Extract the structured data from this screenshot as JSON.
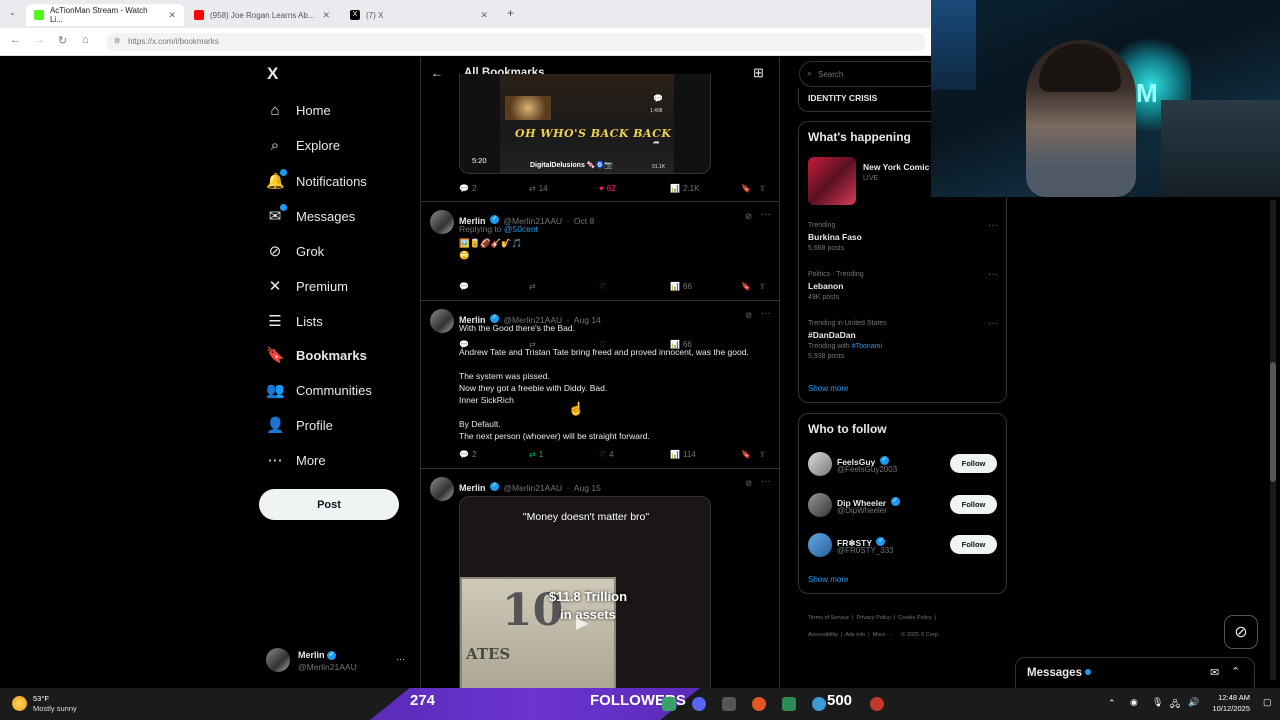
{
  "browser": {
    "tabs": [
      {
        "label": "AcTionMan Stream - Watch Li...",
        "favicon_color": "#53fc18"
      },
      {
        "label": "(958) Joe Rogan Learns Ab...",
        "favicon_color": "#ff0000"
      },
      {
        "label": "(7) X",
        "favicon_color": "#000000"
      }
    ],
    "url": "https://x.com/i/bookmarks",
    "new_tab": "+"
  },
  "sidebar": {
    "logo": "X",
    "items": [
      {
        "label": "Home",
        "icon": "home-icon",
        "glyph": "⌂"
      },
      {
        "label": "Explore",
        "icon": "search-icon",
        "glyph": "⌕"
      },
      {
        "label": "Notifications",
        "icon": "bell-icon",
        "glyph": "🔔"
      },
      {
        "label": "Messages",
        "icon": "mail-icon",
        "glyph": "✉"
      },
      {
        "label": "Grok",
        "icon": "grok-icon",
        "glyph": "⊘"
      },
      {
        "label": "Premium",
        "icon": "x-icon",
        "glyph": "✕"
      },
      {
        "label": "Lists",
        "icon": "list-icon",
        "glyph": "☰"
      },
      {
        "label": "Bookmarks",
        "icon": "bookmark-icon",
        "glyph": "🔖"
      },
      {
        "label": "Communities",
        "icon": "people-icon",
        "glyph": "👥"
      },
      {
        "label": "Profile",
        "icon": "person-icon",
        "glyph": "👤"
      },
      {
        "label": "More",
        "icon": "more-circle-icon",
        "glyph": "⋯"
      }
    ],
    "post_label": "Post",
    "account": {
      "name": "Merlin",
      "handle": "@Merlin21AAU",
      "more": "···"
    }
  },
  "header": {
    "title": "All Bookmarks"
  },
  "tweets": [
    {
      "video": {
        "caption": "OH WHO'S BACK BACK",
        "duration": "5:20",
        "channel": "DigitalDelusions 🍬🧿📷",
        "side_counts": [
          "1,498",
          "91.1K"
        ]
      },
      "stats": {
        "replies": "2",
        "reposts": "14",
        "likes": "62",
        "views": "2.1K"
      }
    },
    {
      "name": "Merlin",
      "handle": "@Merlin21AAU",
      "time": "Oct 8",
      "replying_prefix": "Replying to ",
      "replying_to": "@50cent",
      "text": "🖼️🥫🏈🎸🎷🎵\n🙄",
      "stats": {
        "replies": "",
        "reposts": "",
        "likes": "",
        "views": "66"
      }
    },
    {
      "name": "Merlin",
      "handle": "@Merlin21AAU",
      "time": "Aug 14",
      "text": "With the Good there's the Bad.\n\nAndrew Tate and Tristan Tate bring freed and proved innocent, was the good.\n\nThe system was pissed.\nNow they got a freebie with Diddy. Bad.\nInner SickRich\n\nBy Default.\nThe next person (whoever) will be straight forward.",
      "stats": {
        "replies": "2",
        "reposts": "1",
        "likes": "4",
        "views": "114"
      }
    },
    {
      "name": "Merlin",
      "handle": "@Merlin21AAU",
      "time": "Aug 15",
      "video": {
        "caption": "\"Money doesn't matter bro\"",
        "overlay1": "$11.8 Trillion",
        "overlay2": "in assets",
        "bill": "ATES"
      }
    }
  ],
  "right": {
    "search_placeholder": "Search",
    "identity": "IDENTITY CRISIS",
    "happening": {
      "title": "What's happening",
      "event": {
        "name": "New York Comic",
        "status": "LIVE"
      },
      "trends": [
        {
          "context": "Trending",
          "name": "Burkina Faso",
          "posts": "5,668 posts"
        },
        {
          "context": "Politics · Trending",
          "name": "Lebanon",
          "posts": "49K posts"
        },
        {
          "context": "Trending in United States",
          "name": "#DanDaDan",
          "with_prefix": "Trending with ",
          "with": "#Toonami",
          "posts": "5,938 posts"
        }
      ],
      "show_more": "Show more"
    },
    "who_to_follow": {
      "title": "Who to follow",
      "users": [
        {
          "name": "FeelsGuy",
          "handle": "@FeelsGuy2003",
          "button": "Follow"
        },
        {
          "name": "Dip Wheeler",
          "handle": "@DipWheeler",
          "button": "Follow"
        },
        {
          "name": "FR❄STY",
          "handle": "@FR0STY_333",
          "button": "Follow"
        }
      ],
      "show_more": "Show more"
    },
    "footer": [
      "Terms of Service",
      "Privacy Policy",
      "Cookie Policy",
      "Accessibility",
      "Ads info",
      "More ···",
      "© 2025 X Corp."
    ],
    "messages_label": "Messages"
  },
  "taskbar": {
    "weather_temp": "53°F",
    "weather_desc": "Mostly sunny",
    "followers_count": "274",
    "followers_label": "FOLLOWERS",
    "goal": "500",
    "time": "12:48 AM",
    "date": "10/12/2025"
  }
}
